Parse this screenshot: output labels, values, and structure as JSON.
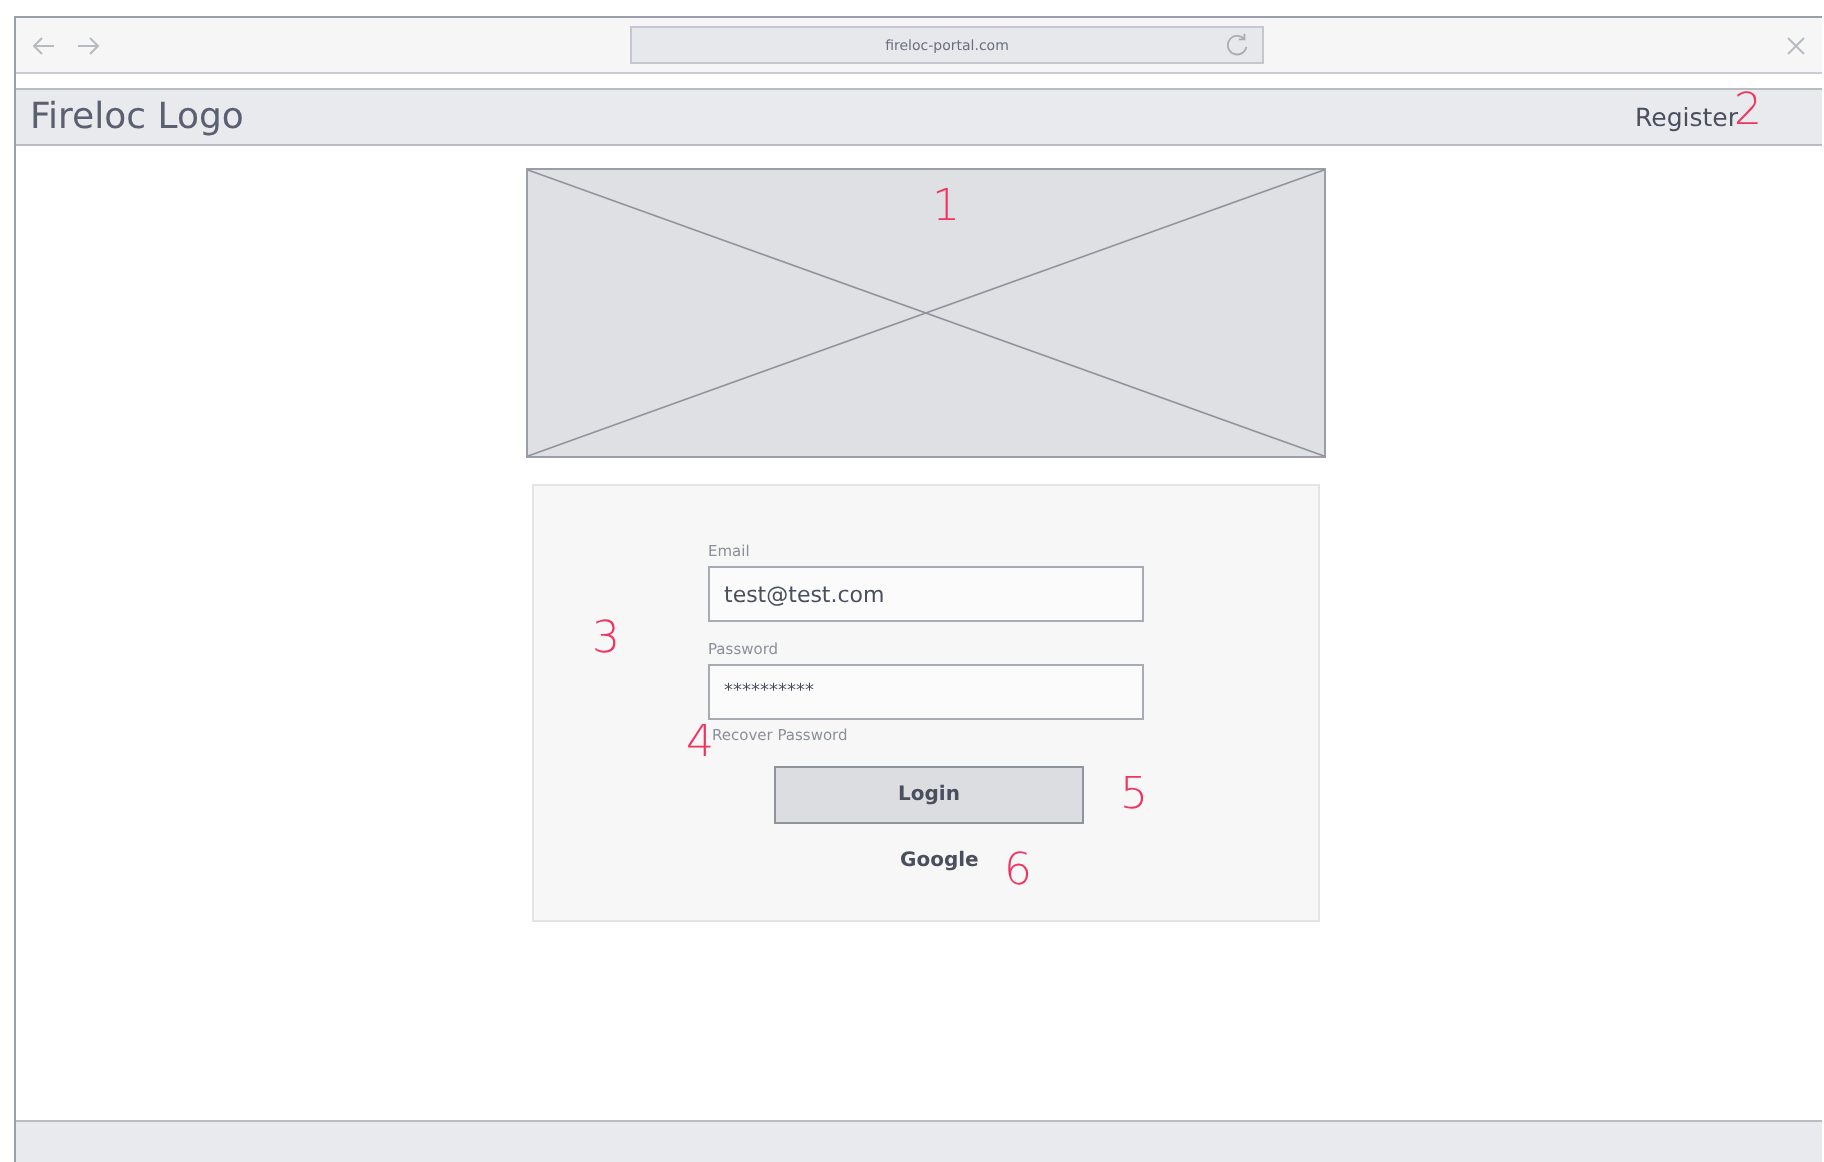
{
  "browser": {
    "url": "fireloc-portal.com"
  },
  "header": {
    "logo": "Fireloc Logo",
    "register_link": "Register"
  },
  "login": {
    "email_label": "Email",
    "email_value": "test@test.com",
    "password_label": "Password",
    "password_value": "**********",
    "recover_link": "Recover Password",
    "login_button": "Login",
    "google_link": "Google"
  },
  "annotations": [
    {
      "kind": "image",
      "label": "1"
    },
    {
      "kind": "register",
      "label": "2"
    },
    {
      "kind": "form",
      "label": "3"
    },
    {
      "kind": "recover",
      "label": "4"
    },
    {
      "kind": "login",
      "label": "5"
    },
    {
      "kind": "google",
      "label": "6"
    }
  ]
}
